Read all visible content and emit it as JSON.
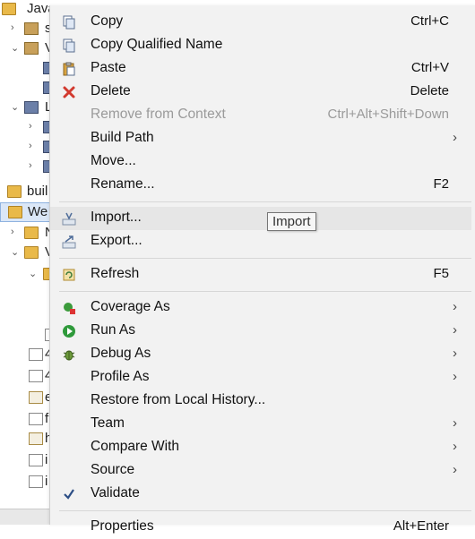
{
  "explorer": {
    "rows": [
      {
        "text": "Java",
        "chev": ""
      },
      {
        "text": "s",
        "chev": "›"
      },
      {
        "text": "V",
        "chev": "⌄"
      },
      {
        "text": "",
        "chev": ""
      },
      {
        "text": "",
        "chev": ""
      },
      {
        "text": "L",
        "chev": "⌄"
      },
      {
        "text": "",
        "chev": "›"
      },
      {
        "text": "",
        "chev": "›"
      },
      {
        "text": "",
        "chev": "›"
      },
      {
        "text": "buil",
        "chev": ""
      },
      {
        "text": "We",
        "chev": "⌄"
      },
      {
        "text": "N",
        "chev": "›"
      },
      {
        "text": "V",
        "chev": "⌄"
      },
      {
        "text": "",
        "chev": "⌄"
      },
      {
        "text": "4",
        "chev": ""
      },
      {
        "text": "4",
        "chev": ""
      },
      {
        "text": "e",
        "chev": ""
      },
      {
        "text": "f",
        "chev": ""
      },
      {
        "text": "h",
        "chev": ""
      },
      {
        "text": "i",
        "chev": ""
      },
      {
        "text": "i",
        "chev": ""
      }
    ]
  },
  "menu": {
    "items": [
      {
        "label": "Copy",
        "accel": "Ctrl+C"
      },
      {
        "label": "Copy Qualified Name",
        "accel": ""
      },
      {
        "label": "Paste",
        "accel": "Ctrl+V"
      },
      {
        "label": "Delete",
        "accel": "Delete"
      },
      {
        "label": "Remove from Context",
        "accel": "Ctrl+Alt+Shift+Down"
      },
      {
        "label": "Build Path",
        "accel": ""
      },
      {
        "label": "Move...",
        "accel": ""
      },
      {
        "label": "Rename...",
        "accel": "F2"
      },
      {
        "label": "Import...",
        "accel": ""
      },
      {
        "label": "Export...",
        "accel": ""
      },
      {
        "label": "Refresh",
        "accel": "F5"
      },
      {
        "label": "Coverage As",
        "accel": ""
      },
      {
        "label": "Run As",
        "accel": ""
      },
      {
        "label": "Debug As",
        "accel": ""
      },
      {
        "label": "Profile As",
        "accel": ""
      },
      {
        "label": "Restore from Local History...",
        "accel": ""
      },
      {
        "label": "Team",
        "accel": ""
      },
      {
        "label": "Compare With",
        "accel": ""
      },
      {
        "label": "Source",
        "accel": ""
      },
      {
        "label": "Validate",
        "accel": ""
      },
      {
        "label": "Properties",
        "accel": "Alt+Enter"
      }
    ],
    "submenu_arrow": "›"
  },
  "tooltip": {
    "text": "Import"
  },
  "colors": {
    "menu_bg": "#f2f2f2",
    "hover_bg": "#e6e6e6",
    "disabled_text": "#9a9a9a",
    "selection": "#dbe7f7"
  }
}
